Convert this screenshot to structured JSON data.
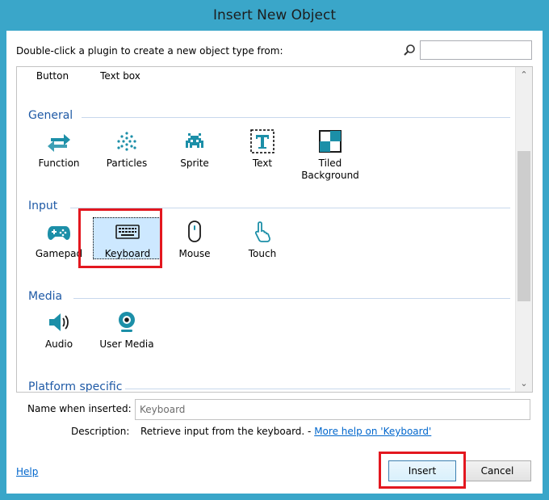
{
  "window": {
    "title": "Insert New Object"
  },
  "top": {
    "prompt": "Double-click a plugin to create a new object type from:",
    "search_value": ""
  },
  "list": {
    "partial_row": [
      {
        "label": "Button"
      },
      {
        "label": "Text box"
      }
    ],
    "categories": [
      {
        "name": "General",
        "items": [
          {
            "label": "Function",
            "icon": "function-icon"
          },
          {
            "label": "Particles",
            "icon": "particles-icon"
          },
          {
            "label": "Sprite",
            "icon": "sprite-icon"
          },
          {
            "label": "Text",
            "icon": "text-icon"
          },
          {
            "label": "Tiled Background",
            "icon": "tiled-background-icon"
          }
        ]
      },
      {
        "name": "Input",
        "items": [
          {
            "label": "Gamepad",
            "icon": "gamepad-icon"
          },
          {
            "label": "Keyboard",
            "icon": "keyboard-icon",
            "selected": true
          },
          {
            "label": "Mouse",
            "icon": "mouse-icon"
          },
          {
            "label": "Touch",
            "icon": "touch-icon"
          }
        ]
      },
      {
        "name": "Media",
        "items": [
          {
            "label": "Audio",
            "icon": "audio-icon"
          },
          {
            "label": "User Media",
            "icon": "user-media-icon"
          }
        ]
      },
      {
        "name": "Platform specific",
        "items": []
      }
    ]
  },
  "form": {
    "name_label": "Name when inserted:",
    "name_value": "Keyboard",
    "description_label": "Description:",
    "description_text": "Retrieve input from the keyboard. - ",
    "description_link": "More help on 'Keyboard'"
  },
  "footer": {
    "help_label": "Help",
    "insert_label": "Insert",
    "cancel_label": "Cancel"
  },
  "colors": {
    "frame": "#3aa6c9",
    "category_text": "#1f5aa6",
    "icon_teal": "#1c8fa8",
    "highlight_red": "#e3171f",
    "link": "#0066cc",
    "selection": "#cde8ff"
  }
}
